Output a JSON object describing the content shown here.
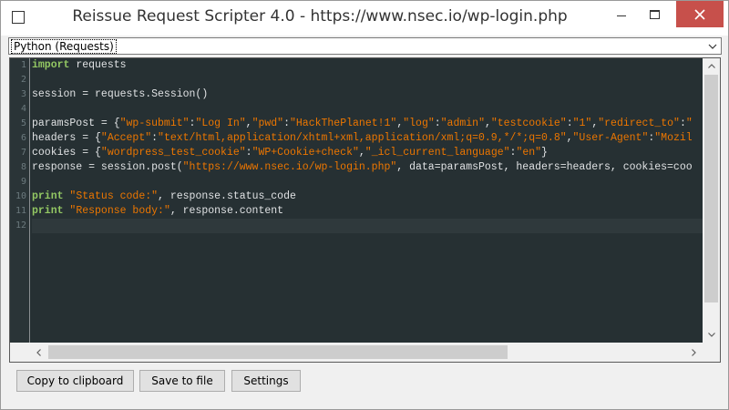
{
  "window": {
    "title": "Reissue Request Scripter 4.0 - https://www.nsec.io/wp-login.php",
    "close_color": "#c7504b"
  },
  "language_select": {
    "selected": "Python (Requests)"
  },
  "editor": {
    "line_numbers": [
      "1",
      "2",
      "3",
      "4",
      "5",
      "6",
      "7",
      "8",
      "9",
      "10",
      "11",
      "12"
    ],
    "current_line": 12,
    "lines": [
      [
        {
          "t": "kw",
          "v": "import"
        },
        {
          "t": "plain",
          "v": " requests"
        }
      ],
      [],
      [
        {
          "t": "plain",
          "v": "session = requests.Session()"
        }
      ],
      [],
      [
        {
          "t": "plain",
          "v": "paramsPost = {"
        },
        {
          "t": "str",
          "v": "\"wp-submit\""
        },
        {
          "t": "plain",
          "v": ":"
        },
        {
          "t": "str",
          "v": "\"Log In\""
        },
        {
          "t": "plain",
          "v": ","
        },
        {
          "t": "str",
          "v": "\"pwd\""
        },
        {
          "t": "plain",
          "v": ":"
        },
        {
          "t": "str",
          "v": "\"HackThePlanet!1\""
        },
        {
          "t": "plain",
          "v": ","
        },
        {
          "t": "str",
          "v": "\"log\""
        },
        {
          "t": "plain",
          "v": ":"
        },
        {
          "t": "str",
          "v": "\"admin\""
        },
        {
          "t": "plain",
          "v": ","
        },
        {
          "t": "str",
          "v": "\"testcookie\""
        },
        {
          "t": "plain",
          "v": ":"
        },
        {
          "t": "str",
          "v": "\"1\""
        },
        {
          "t": "plain",
          "v": ","
        },
        {
          "t": "str",
          "v": "\"redirect_to\""
        },
        {
          "t": "plain",
          "v": ":"
        },
        {
          "t": "str",
          "v": "\""
        }
      ],
      [
        {
          "t": "plain",
          "v": "headers = {"
        },
        {
          "t": "str",
          "v": "\"Accept\""
        },
        {
          "t": "plain",
          "v": ":"
        },
        {
          "t": "str",
          "v": "\"text/html,application/xhtml+xml,application/xml;q=0.9,*/*;q=0.8\""
        },
        {
          "t": "plain",
          "v": ","
        },
        {
          "t": "str",
          "v": "\"User-Agent\""
        },
        {
          "t": "plain",
          "v": ":"
        },
        {
          "t": "str",
          "v": "\"Mozil"
        }
      ],
      [
        {
          "t": "plain",
          "v": "cookies = {"
        },
        {
          "t": "str",
          "v": "\"wordpress_test_cookie\""
        },
        {
          "t": "plain",
          "v": ":"
        },
        {
          "t": "str",
          "v": "\"WP+Cookie+check\""
        },
        {
          "t": "plain",
          "v": ","
        },
        {
          "t": "str",
          "v": "\"_icl_current_language\""
        },
        {
          "t": "plain",
          "v": ":"
        },
        {
          "t": "str",
          "v": "\"en\""
        },
        {
          "t": "plain",
          "v": "}"
        }
      ],
      [
        {
          "t": "plain",
          "v": "response = session.post("
        },
        {
          "t": "str",
          "v": "\"https://www.nsec.io/wp-login.php\""
        },
        {
          "t": "plain",
          "v": ", data=paramsPost, headers=headers, cookies=coo"
        }
      ],
      [],
      [
        {
          "t": "kw",
          "v": "print"
        },
        {
          "t": "plain",
          "v": " "
        },
        {
          "t": "str",
          "v": "\"Status code:\""
        },
        {
          "t": "plain",
          "v": ", response.status_code"
        }
      ],
      [
        {
          "t": "kw",
          "v": "print"
        },
        {
          "t": "plain",
          "v": " "
        },
        {
          "t": "str",
          "v": "\"Response body:\""
        },
        {
          "t": "plain",
          "v": ", response.content"
        }
      ],
      []
    ],
    "colors": {
      "background": "#263033",
      "keyword": "#93c763",
      "string": "#ec7600",
      "text": "#e0e2e4"
    }
  },
  "buttons": {
    "copy": "Copy to clipboard",
    "save": "Save to file",
    "settings": "Settings"
  }
}
